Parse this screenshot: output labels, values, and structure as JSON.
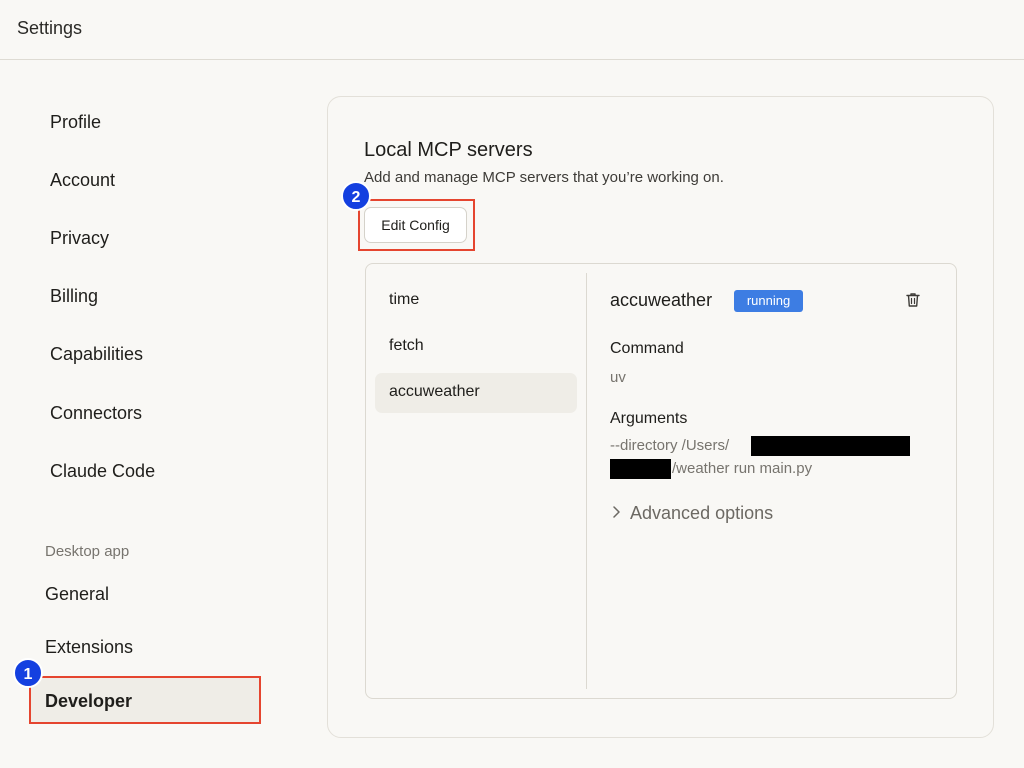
{
  "app": {
    "title": "Settings"
  },
  "sidebar": {
    "items": [
      {
        "label": "Profile"
      },
      {
        "label": "Account"
      },
      {
        "label": "Privacy"
      },
      {
        "label": "Billing"
      },
      {
        "label": "Capabilities"
      },
      {
        "label": "Connectors"
      },
      {
        "label": "Claude Code"
      }
    ],
    "section_label": "Desktop app",
    "desktop_items": [
      {
        "label": "General"
      },
      {
        "label": "Extensions"
      },
      {
        "label": "Developer",
        "active": true
      }
    ]
  },
  "annotations": {
    "step1": "1",
    "step2": "2"
  },
  "panel": {
    "title": "Local MCP servers",
    "subtitle": "Add and manage MCP servers that you’re working on.",
    "edit_config_label": "Edit Config"
  },
  "servers": {
    "list": [
      {
        "name": "time"
      },
      {
        "name": "fetch"
      },
      {
        "name": "accuweather",
        "selected": true
      }
    ],
    "detail": {
      "name": "accuweather",
      "status": "running",
      "command_label": "Command",
      "command_value": "uv",
      "arguments_label": "Arguments",
      "arguments_line1_prefix": "--directory /Users/",
      "arguments_line2_suffix": "/weather run main.py",
      "advanced_label": "Advanced options"
    }
  },
  "icons": {
    "delete": "trash-icon",
    "expand": "chevron-right-icon"
  },
  "colors": {
    "status_running": "#3d7de3",
    "annotation_badge": "#1440e0",
    "highlight_border": "#e5452f"
  }
}
